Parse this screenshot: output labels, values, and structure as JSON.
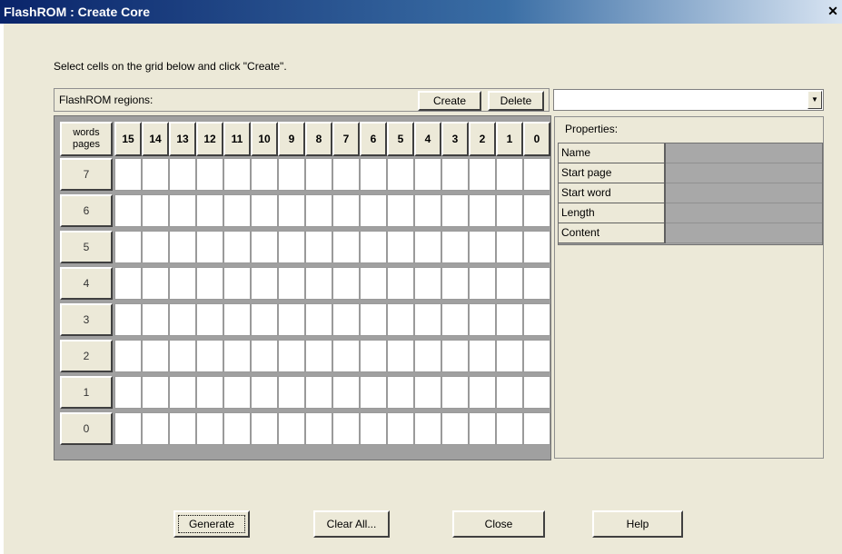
{
  "window": {
    "title": "FlashROM : Create Core",
    "close_glyph": "✕"
  },
  "instruction": "Select cells on the grid below and click \"Create\".",
  "regions": {
    "label": "FlashROM regions:",
    "create_label": "Create",
    "delete_label": "Delete",
    "combo_value": "",
    "combo_arrow": "▼"
  },
  "grid": {
    "corner_top": "words",
    "corner_bottom": "pages",
    "words": [
      "15",
      "14",
      "13",
      "12",
      "11",
      "10",
      "9",
      "8",
      "7",
      "6",
      "5",
      "4",
      "3",
      "2",
      "1",
      "0"
    ],
    "pages": [
      "7",
      "6",
      "5",
      "4",
      "3",
      "2",
      "1",
      "0"
    ]
  },
  "properties": {
    "title": "Properties:",
    "rows": [
      {
        "label": "Name",
        "value": ""
      },
      {
        "label": "Start page",
        "value": ""
      },
      {
        "label": "Start word",
        "value": ""
      },
      {
        "label": "Length",
        "value": ""
      },
      {
        "label": "Content",
        "value": ""
      }
    ]
  },
  "footer": {
    "generate_label": "Generate",
    "clear_label": "Clear All...",
    "close_label": "Close",
    "help_label": "Help"
  },
  "colors": {
    "titlebar": "#0a246a",
    "dialog_bg": "#ece9d8",
    "grid_bg": "#a0a0a0",
    "cell_bg": "#ffffff"
  }
}
